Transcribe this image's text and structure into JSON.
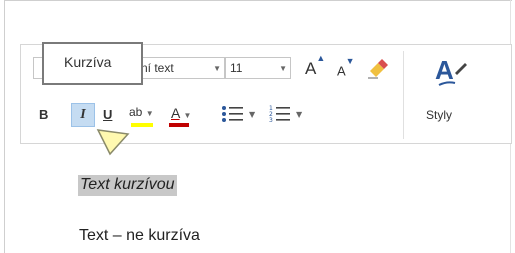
{
  "ribbon": {
    "font_name_partial": "ní text",
    "font_size": "11",
    "styles_label": "Styly",
    "bold_label": "B",
    "italic_label": "I",
    "underline_label": "U",
    "highlight_label": "ab",
    "font_color_label": "A",
    "grow_font_label": "A",
    "shrink_font_label": "A"
  },
  "tooltip": {
    "text": "Kurzíva"
  },
  "document": {
    "line1": "Text kurzívou",
    "line2": "Text – ne kurzíva"
  },
  "colors": {
    "highlight": "#ffff00",
    "font_color": "#c00000",
    "accent": "#2b579a",
    "selected_button": "#c5dcf2"
  }
}
